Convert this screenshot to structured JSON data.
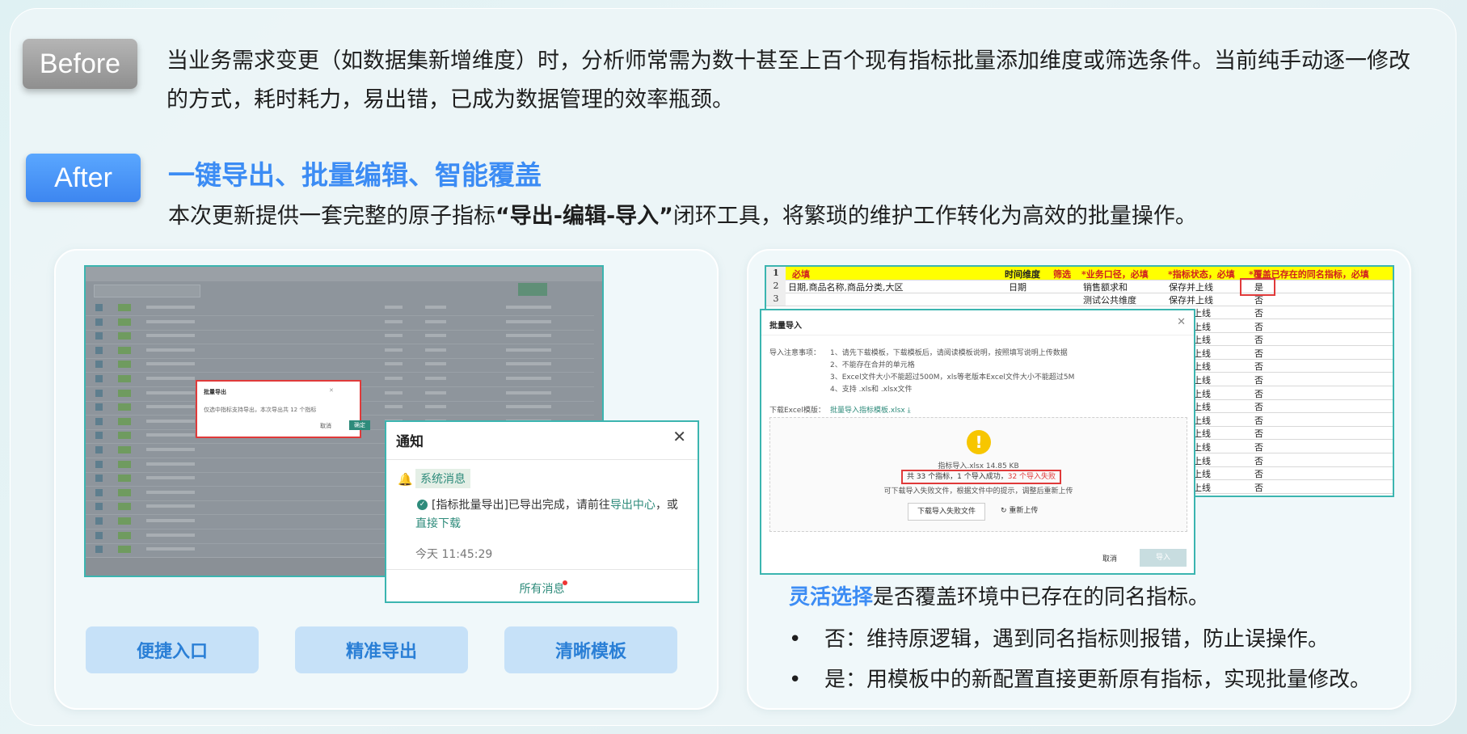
{
  "before": {
    "tag": "Before",
    "text": "当业务需求变更（如数据集新增维度）时，分析师常需为数十甚至上百个现有指标批量添加维度或筛选条件。当前纯手动逐一修改的方式，耗时耗力，易出错，已成为数据管理的效率瓶颈。"
  },
  "after": {
    "tag": "After",
    "title": "一键导出、批量编辑、智能覆盖",
    "desc_prefix": "本次更新提供一套完整的原子指标",
    "desc_bold": "“导出-编辑-导入”",
    "desc_suffix": "闭环工具，将繁琐的维护工作转化为高效的批量操作。"
  },
  "export_dialog": {
    "title": "批量导出",
    "message": "仅选中指标支持导出，本次导出共 12 个指标",
    "cancel": "取消",
    "confirm": "确定"
  },
  "notification": {
    "title": "通知",
    "category": "系统消息",
    "message_prefix": "[指标批量导出]已导出完成，请前往",
    "message_link1": "导出中心",
    "message_mid": "，或",
    "message_link2": "直接下载",
    "time": "今天 11:45:29",
    "all_messages": "所有消息"
  },
  "features": [
    "便捷入口",
    "精准导出",
    "清晰模板"
  ],
  "sheet": {
    "header": [
      "1",
      "必填",
      "时间维度",
      "筛选",
      "*业务口径，必填",
      "*指标状态，必填",
      "*覆盖已存在的同名指标，必填"
    ],
    "row2": [
      "2",
      "日期,商品名称,商品分类,大区",
      "日期",
      "销售额求和",
      "保存并上线",
      "是"
    ],
    "row3": [
      "3",
      "测试公共维度",
      "保存并上线",
      "否"
    ],
    "status_repeat": "上线",
    "no": "否"
  },
  "import_dialog": {
    "title": "批量导入",
    "notes_label": "导入注意事项：",
    "notes": [
      "1、请先下载模板，下载模板后，请阅读模板说明，按照填写说明上传数据",
      "2、不能存在合并的单元格",
      "3、Excel文件大小不能超过500M，xls等老版本Excel文件大小不能超过5M",
      "4、支持 .xls和 .xlsx文件"
    ],
    "download_label": "下载Excel模版：",
    "download_link": "批量导入指标模板.xlsx",
    "file_info": "指标导入.xlsx  14.85 KB",
    "result_prefix": "共 33 个指标，1 个导入成功，",
    "result_fail": "32 个导入失败",
    "hint": "可下载导入失败文件，根据文件中的提示，调整后重新上传",
    "download_fail": "下载导入失败文件",
    "reupload": "重新上传",
    "cancel": "取消",
    "submit": "导入"
  },
  "right_text": {
    "lead_highlight": "灵活选择",
    "lead_rest": "是否覆盖环境中已存在的同名指标。",
    "bullet1": "否：维持原逻辑，遇到同名指标则报错，防止误操作。",
    "bullet2": "是：用模板中的新配置直接更新原有指标，实现批量修改。"
  }
}
